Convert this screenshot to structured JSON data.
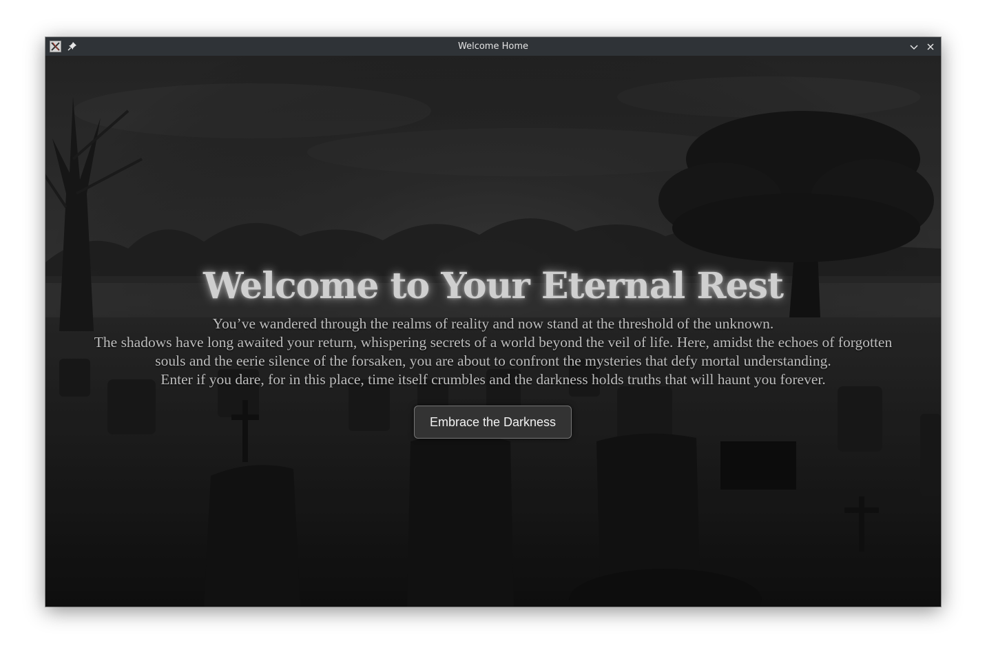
{
  "window": {
    "title": "Welcome Home",
    "app_icon": "x-window-icon",
    "pin_icon": "pin-icon",
    "minimize_icon": "chevron-down-icon",
    "close_icon": "close-icon"
  },
  "hero": {
    "headline": "Welcome to Your Eternal Rest",
    "paragraph_lines": [
      "You’ve wandered through the realms of reality and now stand at the threshold of the unknown.",
      "The shadows have long awaited your return, whispering secrets of a world beyond the veil of life. Here, amidst the echoes of forgotten",
      "souls and the eerie silence of the forsaken, you are about to confront the mysteries that defy mortal understanding.",
      "Enter if you dare, for in this place, time itself crumbles and the darkness holds truths that will haunt you forever."
    ],
    "button_label": "Embrace the Darkness"
  },
  "colors": {
    "titlebar": "#2f3337",
    "background": "#1b1b1b",
    "headline": "#cfcfcf",
    "button_bg": "#333333"
  }
}
